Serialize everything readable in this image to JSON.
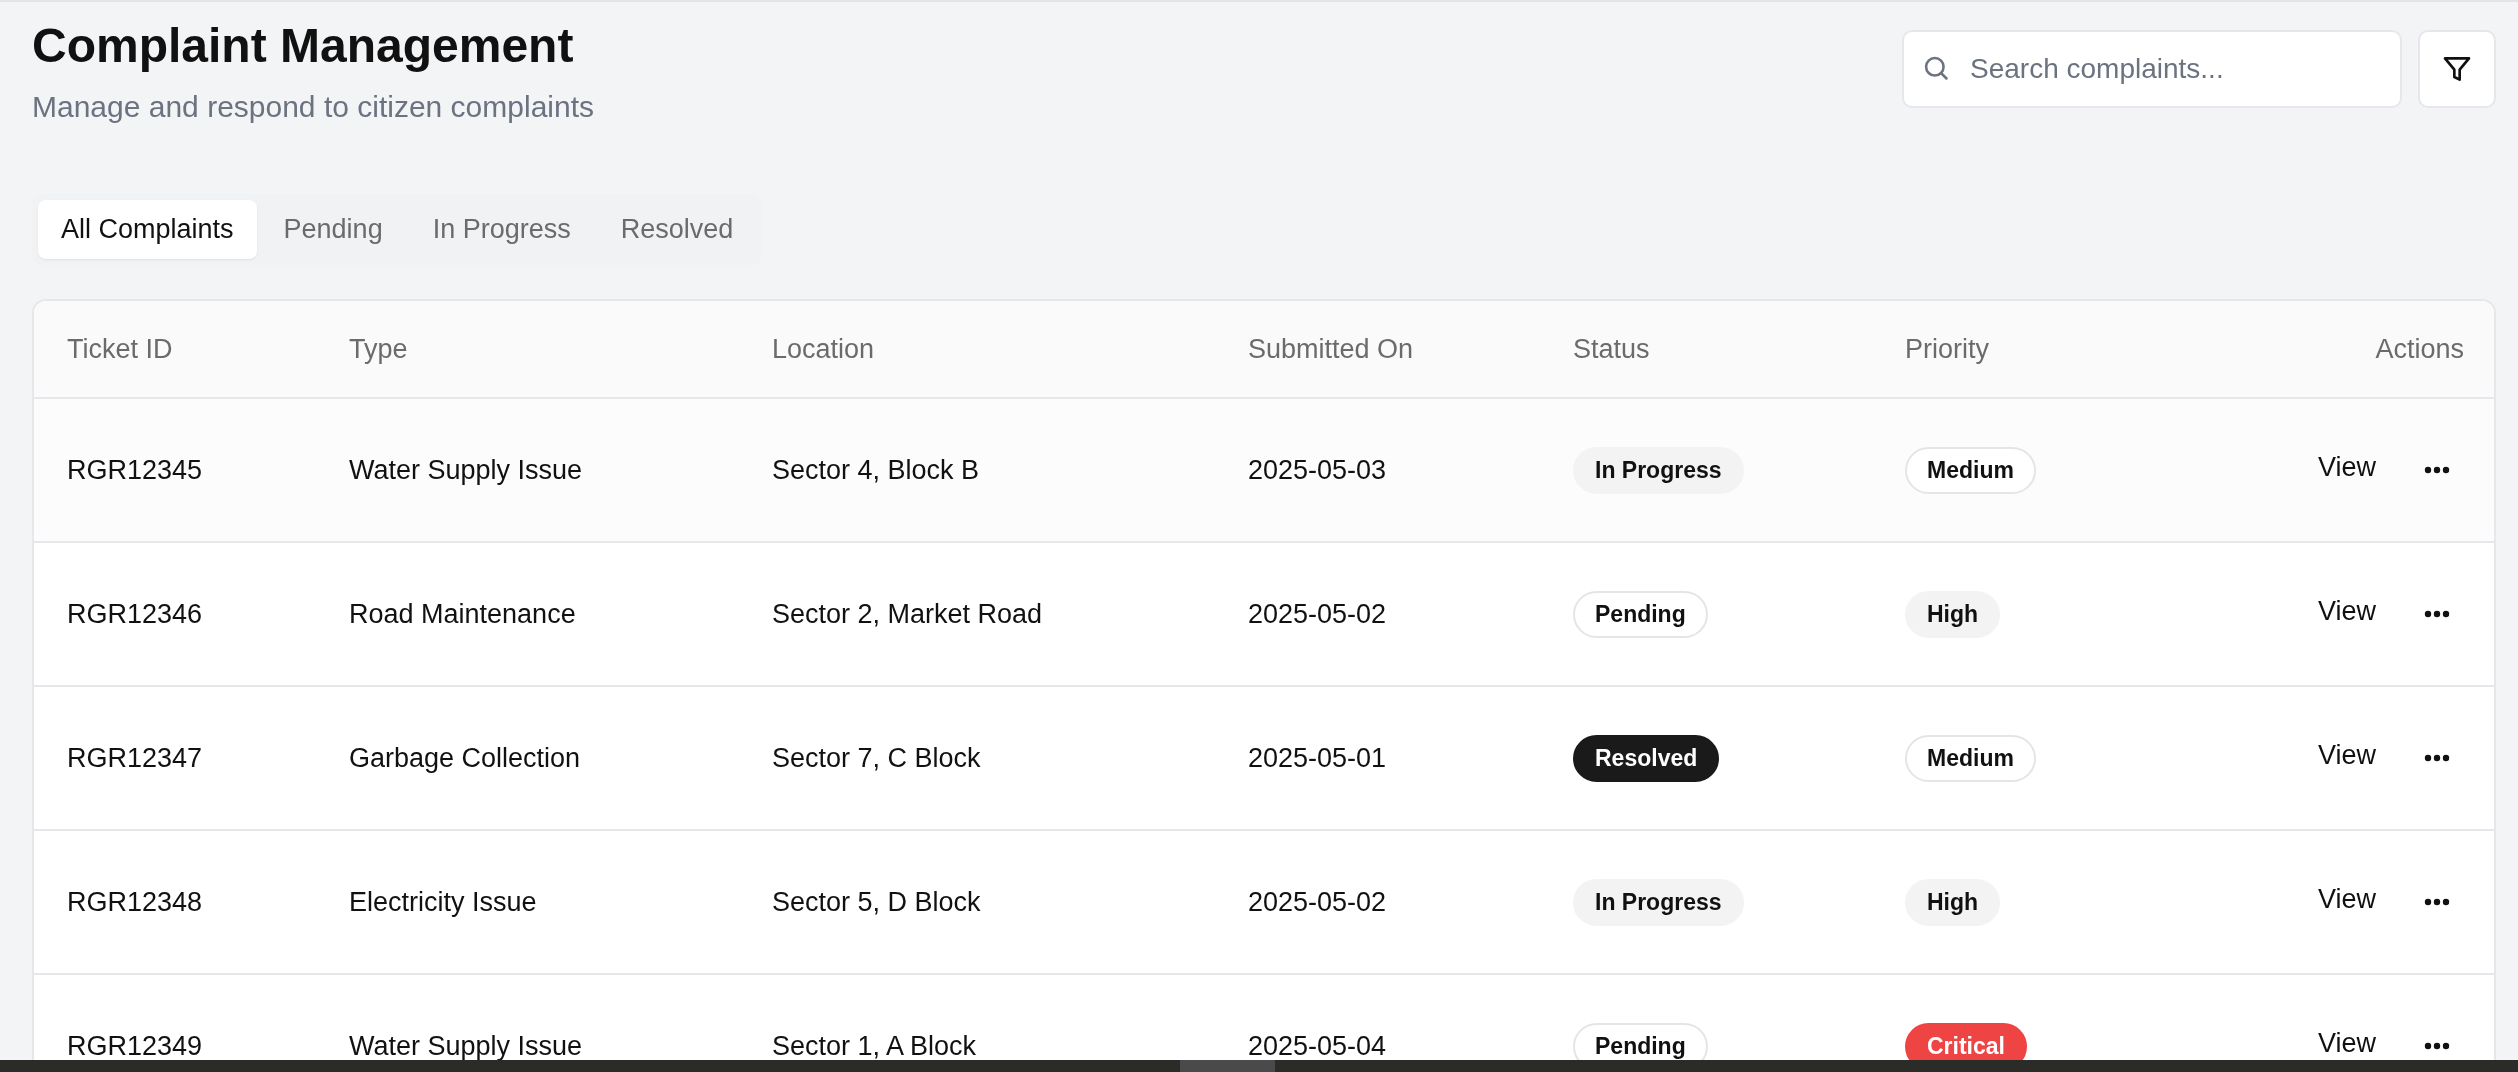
{
  "header": {
    "title": "Complaint Management",
    "subtitle": "Manage and respond to citizen complaints"
  },
  "search": {
    "placeholder": "Search complaints..."
  },
  "tabs": [
    {
      "label": "All Complaints",
      "selected": true
    },
    {
      "label": "Pending",
      "selected": false
    },
    {
      "label": "In Progress",
      "selected": false
    },
    {
      "label": "Resolved",
      "selected": false
    }
  ],
  "table": {
    "columns": [
      "Ticket ID",
      "Type",
      "Location",
      "Submitted On",
      "Status",
      "Priority",
      "Actions"
    ],
    "rows": [
      {
        "ticket_id": "RGR12345",
        "type": "Water Supply Issue",
        "location": "Sector 4, Block B",
        "submitted_on": "2025-05-03",
        "status": {
          "label": "In Progress",
          "kind": "soft"
        },
        "priority": {
          "label": "Medium",
          "kind": "outline"
        },
        "action": "View"
      },
      {
        "ticket_id": "RGR12346",
        "type": "Road Maintenance",
        "location": "Sector 2, Market Road",
        "submitted_on": "2025-05-02",
        "status": {
          "label": "Pending",
          "kind": "outline"
        },
        "priority": {
          "label": "High",
          "kind": "soft"
        },
        "action": "View"
      },
      {
        "ticket_id": "RGR12347",
        "type": "Garbage Collection",
        "location": "Sector 7, C Block",
        "submitted_on": "2025-05-01",
        "status": {
          "label": "Resolved",
          "kind": "solid"
        },
        "priority": {
          "label": "Medium",
          "kind": "outline"
        },
        "action": "View"
      },
      {
        "ticket_id": "RGR12348",
        "type": "Electricity Issue",
        "location": "Sector 5, D Block",
        "submitted_on": "2025-05-02",
        "status": {
          "label": "In Progress",
          "kind": "soft"
        },
        "priority": {
          "label": "High",
          "kind": "soft"
        },
        "action": "View"
      },
      {
        "ticket_id": "RGR12349",
        "type": "Water Supply Issue",
        "location": "Sector 1, A Block",
        "submitted_on": "2025-05-04",
        "status": {
          "label": "Pending",
          "kind": "outline"
        },
        "priority": {
          "label": "Critical",
          "kind": "danger"
        },
        "action": "View"
      }
    ]
  }
}
